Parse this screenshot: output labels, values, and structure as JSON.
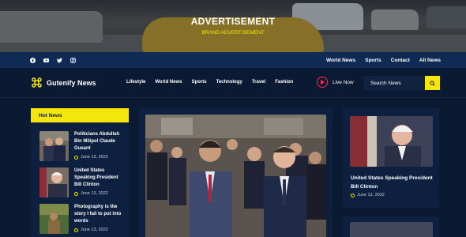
{
  "advertisement": {
    "title": "ADVERTISEMENT",
    "subtitle": "BRAND ADVERTISEMENT"
  },
  "topbar": {
    "socials": [
      "facebook-icon",
      "youtube-icon",
      "twitter-icon",
      "instagram-icon"
    ],
    "links": [
      "World News",
      "Sports",
      "Contact",
      "All News"
    ]
  },
  "nav": {
    "logo": "Gutenify News",
    "menu": [
      "Lifestyle",
      "World News",
      "Sports",
      "Technology",
      "Travel",
      "Fashion"
    ],
    "live_label": "Live Now",
    "search_placeholder": "Search News"
  },
  "hot_news": {
    "heading": "Hot News",
    "items": [
      {
        "title": "Politicians Abdullah Bin Milipol Claude Gueant",
        "date": "June 13, 2022"
      },
      {
        "title": "United States Speaking President Bill Clinton",
        "date": "June 13, 2022"
      },
      {
        "title": "Photography is the story I fail to put into words",
        "date": "June 13, 2022"
      }
    ]
  },
  "side_story": {
    "title": "United States Speaking President Bill Clinton",
    "date": "June 13, 2022"
  },
  "colors": {
    "accent": "#f5e60b",
    "background": "#0b1a33",
    "card": "#0e2040",
    "topbar": "#0e2a55",
    "live": "#ff2a4d"
  }
}
